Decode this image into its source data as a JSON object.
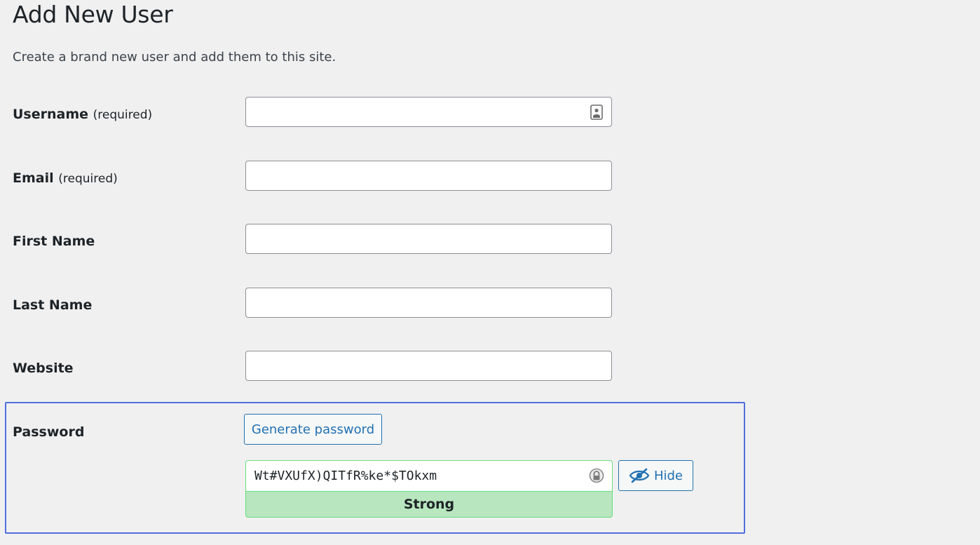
{
  "page": {
    "title": "Add New User",
    "description": "Create a brand new user and add them to this site."
  },
  "fields": {
    "username": {
      "label": "Username",
      "required_note": "(required)",
      "value": ""
    },
    "email": {
      "label": "Email",
      "required_note": "(required)",
      "value": ""
    },
    "first_name": {
      "label": "First Name",
      "value": ""
    },
    "last_name": {
      "label": "Last Name",
      "value": ""
    },
    "website": {
      "label": "Website",
      "value": ""
    }
  },
  "password": {
    "label": "Password",
    "generate_label": "Generate password",
    "value": "Wt#VXUfX)QITfR%ke*$TOkxm",
    "strength": "Strong",
    "hide_label": "Hide"
  },
  "icons": {
    "username_field": "contact-card-icon",
    "password_field": "password-manager-icon",
    "hide_button": "eye-slash-icon"
  },
  "colors": {
    "accent": "#2271b1",
    "strong_bg": "#b8e6bf",
    "strong_border": "#68de7c",
    "highlight": "#4f6fdc"
  }
}
